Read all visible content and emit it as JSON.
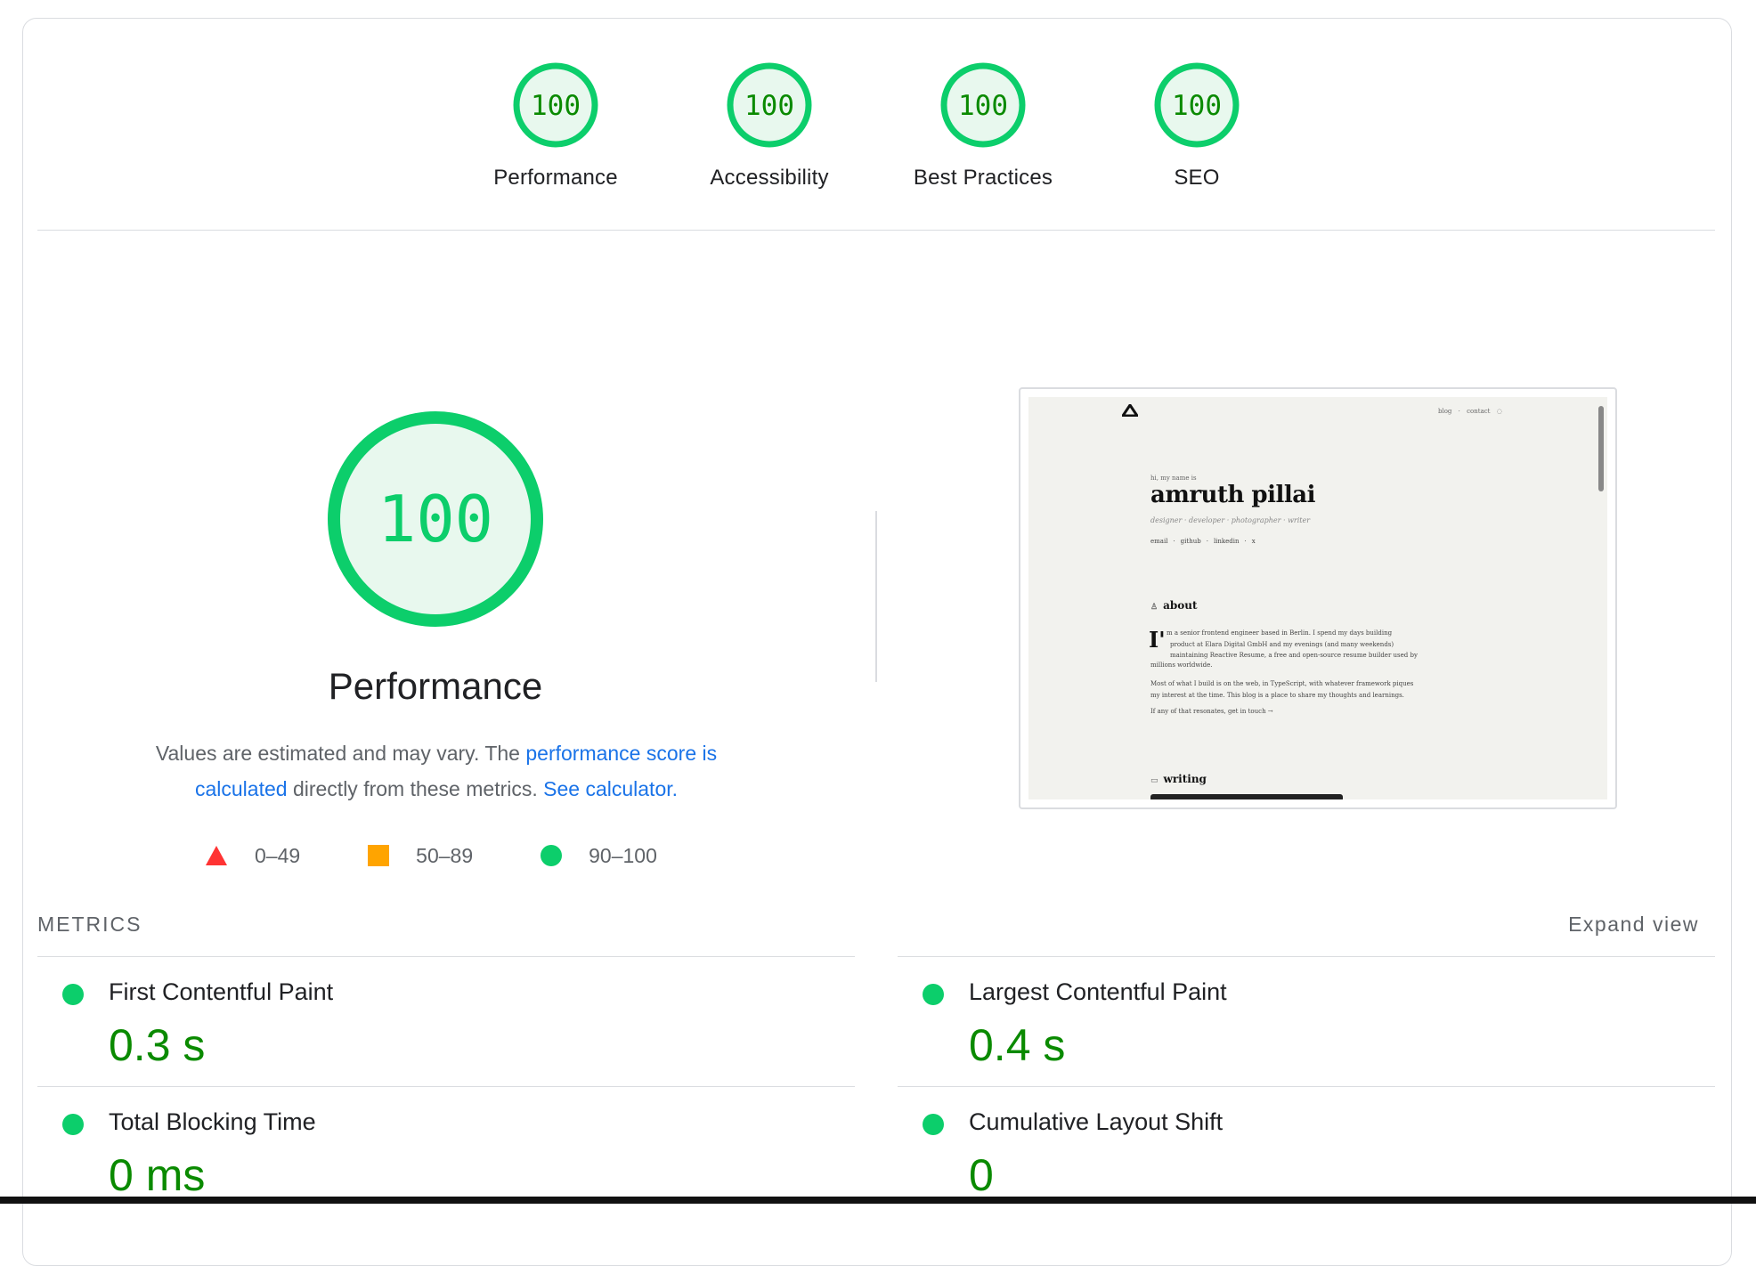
{
  "colors": {
    "pass": "#0cce6b",
    "pass_text": "#0a8a00",
    "pass_bg": "#e8f8ee",
    "average": "#ffa400",
    "fail": "#ff3333",
    "link": "#1a73e8"
  },
  "categories": [
    {
      "score": "100",
      "label": "Performance"
    },
    {
      "score": "100",
      "label": "Accessibility"
    },
    {
      "score": "100",
      "label": "Best Practices"
    },
    {
      "score": "100",
      "label": "SEO"
    }
  ],
  "performance": {
    "score": "100",
    "title": "Performance",
    "desc_pre": "Values are estimated and may vary. The ",
    "desc_link1": "performance score is calculated",
    "desc_mid": " directly from these metrics. ",
    "desc_link2": "See calculator.",
    "legend": [
      {
        "shape": "triangle",
        "range": "0–49"
      },
      {
        "shape": "square",
        "range": "50–89"
      },
      {
        "shape": "circle",
        "range": "90–100"
      }
    ]
  },
  "screenshot": {
    "nav": [
      "blog",
      "contact"
    ],
    "greeting": "hi, my name is",
    "name": "amruth pillai",
    "roles": "designer · developer · photographer · writer",
    "links": [
      "email",
      "github",
      "linkedin",
      "x"
    ],
    "about_heading": "about",
    "about_dropcap": "I'",
    "about_p1_line1": "m a senior frontend engineer based in Berlin. I spend my days building",
    "about_p1_line2": "product at Elara Digital GmbH and my evenings (and many weekends)",
    "about_p1_line3": "maintaining Reactive Resume, a free and open-source resume builder used by",
    "about_p1_line4": "millions worldwide.",
    "about_p2_line1": "Most of what I build is on the web, in TypeScript, with whatever framework piques",
    "about_p2_line2": "my interest at the time. This blog is a place to share my thoughts and learnings.",
    "about_p3": "If any of that resonates, get in touch →",
    "writing_heading": "writing"
  },
  "metrics": {
    "heading": "METRICS",
    "expand": "Expand view",
    "items": [
      {
        "name": "First Contentful Paint",
        "value": "0.3 s"
      },
      {
        "name": "Largest Contentful Paint",
        "value": "0.4 s"
      },
      {
        "name": "Total Blocking Time",
        "value": "0 ms"
      },
      {
        "name": "Cumulative Layout Shift",
        "value": "0"
      }
    ]
  }
}
